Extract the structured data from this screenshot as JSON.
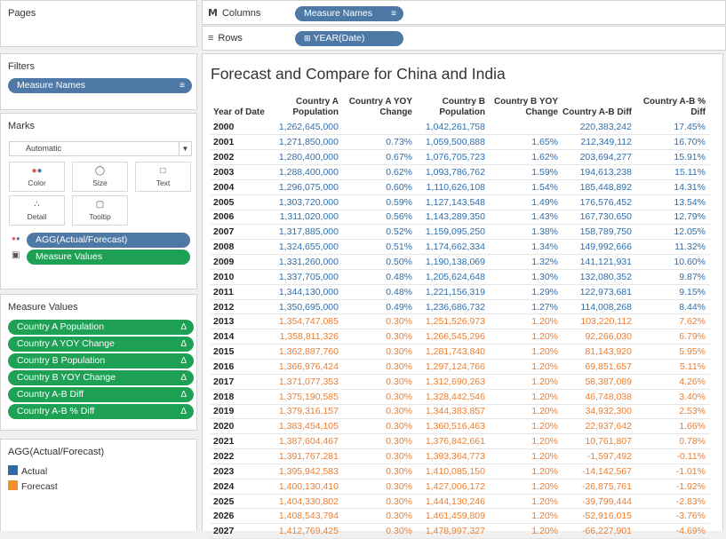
{
  "pages": {
    "title": "Pages"
  },
  "shelves": {
    "columns_label": "Columns",
    "rows_label": "Rows",
    "columns_pill": "Measure Names",
    "rows_pill": "YEAR(Date)"
  },
  "filters": {
    "title": "Filters",
    "pill": "Measure Names"
  },
  "marks": {
    "title": "Marks",
    "type": "Automatic",
    "buttons": [
      "Color",
      "Size",
      "Text",
      "Detail",
      "Tooltip"
    ],
    "pills": [
      "AGG(Actual/Forecast)",
      "Measure Values"
    ]
  },
  "measure_values": {
    "title": "Measure Values",
    "items": [
      "Country A Population",
      "Country A YOY Change",
      "Country B Population",
      "Country B YOY Change",
      "Country A-B Diff",
      "Country A-B % Diff"
    ],
    "icon": "Δ"
  },
  "legend": {
    "title": "AGG(Actual/Forecast)",
    "items": [
      {
        "label": "Actual",
        "color": "#2e6aa6"
      },
      {
        "label": "Forecast",
        "color": "#f28e2b"
      }
    ]
  },
  "view": {
    "title": "Forecast and Compare for China and India",
    "row_header": "Year of Date",
    "columns": [
      [
        "Country A",
        "Population"
      ],
      [
        "Country A YOY",
        "Change"
      ],
      [
        "Country B",
        "Population"
      ],
      [
        "Country B YOY",
        "Change"
      ],
      [
        "",
        "Country A-B Diff"
      ],
      [
        "Country A-B %",
        "Diff"
      ]
    ],
    "rows": [
      {
        "year": "2000",
        "kind": "actual",
        "values": [
          "1,262,645,000",
          "",
          "1,042,261,758",
          "",
          "220,383,242",
          "17.45%"
        ]
      },
      {
        "year": "2001",
        "kind": "actual",
        "values": [
          "1,271,850,000",
          "0.73%",
          "1,059,500,888",
          "1.65%",
          "212,349,112",
          "16.70%"
        ]
      },
      {
        "year": "2002",
        "kind": "actual",
        "values": [
          "1,280,400,000",
          "0.67%",
          "1,076,705,723",
          "1.62%",
          "203,694,277",
          "15.91%"
        ]
      },
      {
        "year": "2003",
        "kind": "actual",
        "values": [
          "1,288,400,000",
          "0.62%",
          "1,093,786,762",
          "1.59%",
          "194,613,238",
          "15.11%"
        ]
      },
      {
        "year": "2004",
        "kind": "actual",
        "values": [
          "1,296,075,000",
          "0.60%",
          "1,110,626,108",
          "1.54%",
          "185,448,892",
          "14.31%"
        ]
      },
      {
        "year": "2005",
        "kind": "actual",
        "values": [
          "1,303,720,000",
          "0.59%",
          "1,127,143,548",
          "1.49%",
          "176,576,452",
          "13.54%"
        ]
      },
      {
        "year": "2006",
        "kind": "actual",
        "values": [
          "1,311,020,000",
          "0.56%",
          "1,143,289,350",
          "1.43%",
          "167,730,650",
          "12.79%"
        ]
      },
      {
        "year": "2007",
        "kind": "actual",
        "values": [
          "1,317,885,000",
          "0.52%",
          "1,159,095,250",
          "1.38%",
          "158,789,750",
          "12.05%"
        ]
      },
      {
        "year": "2008",
        "kind": "actual",
        "values": [
          "1,324,655,000",
          "0.51%",
          "1,174,662,334",
          "1.34%",
          "149,992,666",
          "11.32%"
        ]
      },
      {
        "year": "2009",
        "kind": "actual",
        "values": [
          "1,331,260,000",
          "0.50%",
          "1,190,138,069",
          "1.32%",
          "141,121,931",
          "10.60%"
        ]
      },
      {
        "year": "2010",
        "kind": "actual",
        "values": [
          "1,337,705,000",
          "0.48%",
          "1,205,624,648",
          "1.30%",
          "132,080,352",
          "9.87%"
        ]
      },
      {
        "year": "2011",
        "kind": "actual",
        "values": [
          "1,344,130,000",
          "0.48%",
          "1,221,156,319",
          "1.29%",
          "122,973,681",
          "9.15%"
        ]
      },
      {
        "year": "2012",
        "kind": "actual",
        "values": [
          "1,350,695,000",
          "0.49%",
          "1,236,686,732",
          "1.27%",
          "114,008,268",
          "8.44%"
        ]
      },
      {
        "year": "2013",
        "kind": "forecast",
        "values": [
          "1,354,747,085",
          "0.30%",
          "1,251,526,973",
          "1.20%",
          "103,220,112",
          "7.62%"
        ]
      },
      {
        "year": "2014",
        "kind": "forecast",
        "values": [
          "1,358,811,326",
          "0.30%",
          "1,266,545,296",
          "1.20%",
          "92,266,030",
          "6.79%"
        ]
      },
      {
        "year": "2015",
        "kind": "forecast",
        "values": [
          "1,362,887,760",
          "0.30%",
          "1,281,743,840",
          "1.20%",
          "81,143,920",
          "5.95%"
        ]
      },
      {
        "year": "2016",
        "kind": "forecast",
        "values": [
          "1,366,976,424",
          "0.30%",
          "1,297,124,766",
          "1.20%",
          "69,851,657",
          "5.11%"
        ]
      },
      {
        "year": "2017",
        "kind": "forecast",
        "values": [
          "1,371,077,353",
          "0.30%",
          "1,312,690,263",
          "1.20%",
          "58,387,089",
          "4.26%"
        ]
      },
      {
        "year": "2018",
        "kind": "forecast",
        "values": [
          "1,375,190,585",
          "0.30%",
          "1,328,442,546",
          "1.20%",
          "46,748,038",
          "3.40%"
        ]
      },
      {
        "year": "2019",
        "kind": "forecast",
        "values": [
          "1,379,316,157",
          "0.30%",
          "1,344,383,857",
          "1.20%",
          "34,932,300",
          "2.53%"
        ]
      },
      {
        "year": "2020",
        "kind": "forecast",
        "values": [
          "1,383,454,105",
          "0.30%",
          "1,360,516,463",
          "1.20%",
          "22,937,642",
          "1.66%"
        ]
      },
      {
        "year": "2021",
        "kind": "forecast",
        "values": [
          "1,387,604,467",
          "0.30%",
          "1,376,842,661",
          "1.20%",
          "10,761,807",
          "0.78%"
        ]
      },
      {
        "year": "2022",
        "kind": "forecast",
        "values": [
          "1,391,767,281",
          "0.30%",
          "1,393,364,773",
          "1.20%",
          "-1,597,492",
          "-0.11%"
        ]
      },
      {
        "year": "2023",
        "kind": "forecast",
        "values": [
          "1,395,942,583",
          "0.30%",
          "1,410,085,150",
          "1.20%",
          "-14,142,567",
          "-1.01%"
        ]
      },
      {
        "year": "2024",
        "kind": "forecast",
        "values": [
          "1,400,130,410",
          "0.30%",
          "1,427,006,172",
          "1.20%",
          "-26,875,761",
          "-1.92%"
        ]
      },
      {
        "year": "2025",
        "kind": "forecast",
        "values": [
          "1,404,330,802",
          "0.30%",
          "1,444,130,246",
          "1.20%",
          "-39,799,444",
          "-2.83%"
        ]
      },
      {
        "year": "2026",
        "kind": "forecast",
        "values": [
          "1,408,543,794",
          "0.30%",
          "1,461,459,809",
          "1.20%",
          "-52,916,015",
          "-3.76%"
        ]
      },
      {
        "year": "2027",
        "kind": "forecast",
        "values": [
          "1,412,769,425",
          "0.30%",
          "1,478,997,327",
          "1.20%",
          "-66,227,901",
          "-4.69%"
        ]
      }
    ]
  }
}
